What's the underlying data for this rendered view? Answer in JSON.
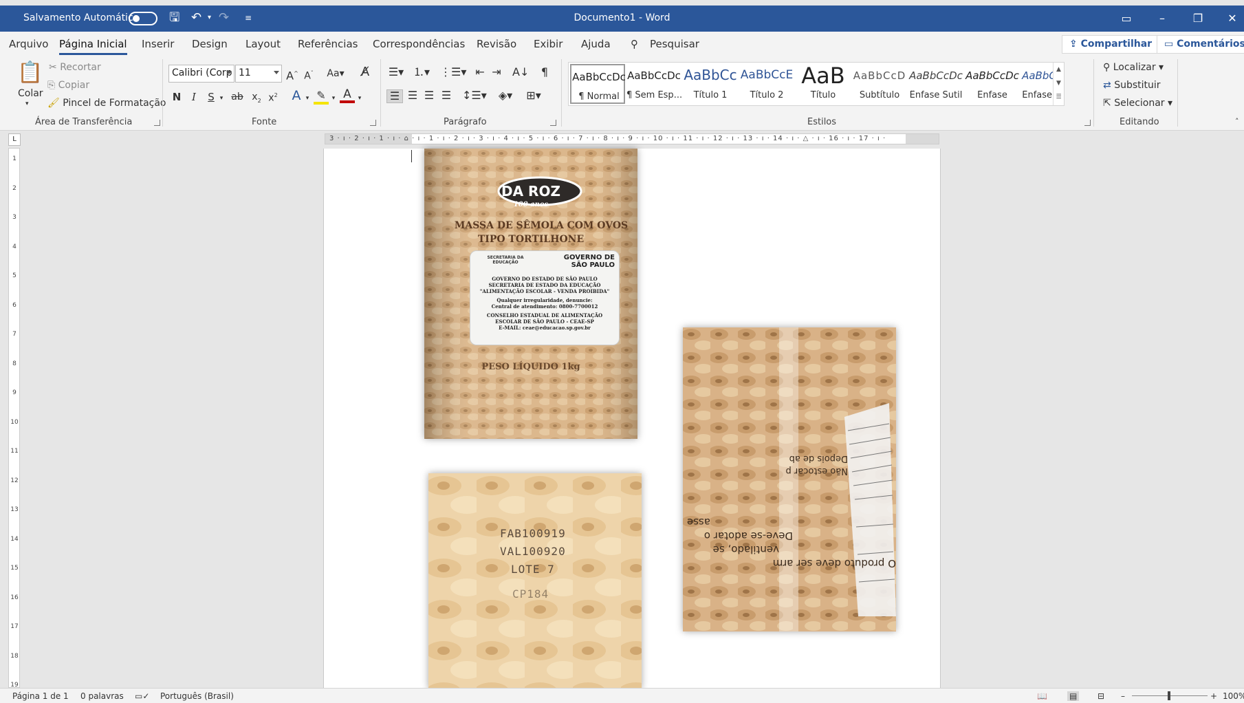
{
  "titlebar": {
    "autosave_label": "Salvamento Automático",
    "document_title": "Documento1  -  Word"
  },
  "menu": {
    "tabs": [
      "Arquivo",
      "Página Inicial",
      "Inserir",
      "Design",
      "Layout",
      "Referências",
      "Correspondências",
      "Revisão",
      "Exibir",
      "Ajuda"
    ],
    "search_label": "Pesquisar",
    "share_label": "Compartilhar",
    "comments_label": "Comentários"
  },
  "ribbon": {
    "clipboard": {
      "paste_label": "Colar",
      "cut_label": "Recortar",
      "copy_label": "Copiar",
      "format_painter_label": "Pincel de Formatação",
      "group_name": "Área de Transferência"
    },
    "font": {
      "font_name": "Calibri (Corp",
      "font_size": "11",
      "bold": "N",
      "italic": "I",
      "underline": "S",
      "strike": "ab",
      "case_label": "Aa",
      "group_name": "Fonte"
    },
    "paragraph": {
      "group_name": "Parágrafo"
    },
    "styles": {
      "group_name": "Estilos",
      "items": [
        {
          "preview": "AaBbCcDc",
          "name": "¶ Normal"
        },
        {
          "preview": "AaBbCcDc",
          "name": "¶ Sem Esp..."
        },
        {
          "preview": "AaBbCc",
          "name": "Título 1"
        },
        {
          "preview": "AaBbCcE",
          "name": "Título 2"
        },
        {
          "preview": "AaB",
          "name": "Título"
        },
        {
          "preview": "AaBbCcD",
          "name": "Subtítulo"
        },
        {
          "preview": "AaBbCcDc",
          "name": "Ênfase Sutil"
        },
        {
          "preview": "AaBbCcDc",
          "name": "Ênfase"
        },
        {
          "preview": "AaBbCcDc",
          "name": "Ênfase Int..."
        }
      ]
    },
    "editing": {
      "find_label": "Localizar",
      "replace_label": "Substituir",
      "select_label": "Selecionar",
      "group_name": "Editando"
    }
  },
  "ruler": {
    "horizontal_text": "3 · ı · 2 · ı · 1 · ı · ⌂ · ı · 1 · ı · 2 · ı · 3 · ı · 4 · ı · 5 · ı · 6 · ı · 7 · ı · 8 · ı · 9 · ı · 10 · ı · 11 · ı · 12 · ı · 13 · ı · 14 · ı · △ · ı · 16 · ı · 17 · ı ·",
    "vertical_numbers": [
      "1",
      "2",
      "3",
      "4",
      "5",
      "6",
      "7",
      "8",
      "9",
      "10",
      "11",
      "12",
      "13",
      "14",
      "15",
      "16",
      "17",
      "18",
      "19"
    ]
  },
  "document": {
    "photo1": {
      "brand": "DA ROZ",
      "brand_sub": "100 anos",
      "line1": "MASSA DE SÊMOLA COM OVOS",
      "line2": "TIPO TORTILHONE",
      "seal_left": "SECRETARIA DA EDUCAÇÃO",
      "seal_right": "GOVERNO DE SÃO PAULO",
      "label_l1": "GOVERNO DO ESTADO DE SÃO PAULO",
      "label_l2": "SECRETARIA DE ESTADO DA EDUCAÇÃO",
      "label_l3": "\"ALIMENTAÇÃO ESCOLAR - VENDA PROIBIDA\"",
      "label_l4": "Qualquer irregularidade, denuncie:",
      "label_l5": "Central de atendimento: 0800-7700012",
      "label_l6": "CONSELHO ESTADUAL DE ALIMENTAÇÃO",
      "label_l7": "ESCOLAR DE SÃO PAULO - CEAE-SP",
      "label_l8": "E-MAIL: ceae@educacao.sp.gov.br",
      "weight": "PESO LÍQUIDO 1kg"
    },
    "photo2": {
      "fab": "FAB100919",
      "val": "VAL100920",
      "lote": "LOTE 7",
      "code": "CP184"
    },
    "photo3": {
      "text1": "Não estocar p",
      "text2": "Depois de ab",
      "text3": "O produto deve ser arm",
      "text4": "ventilado, se",
      "text5": "Deve-se adotar o",
      "text6": "asse"
    }
  },
  "statusbar": {
    "page": "Página 1 de 1",
    "words": "0 palavras",
    "language": "Português (Brasil)",
    "zoom": "100%"
  }
}
